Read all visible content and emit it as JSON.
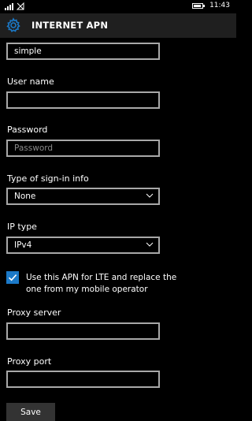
{
  "status_bar": {
    "time": "11:43",
    "icons": [
      "signal-icon",
      "no-signal-icon",
      "battery-icon"
    ]
  },
  "header": {
    "title": "INTERNET APN",
    "icon": "gear-icon"
  },
  "form": {
    "apn_value": "simple",
    "user_name": {
      "label": "User name",
      "value": ""
    },
    "password": {
      "label": "Password",
      "placeholder": "Password"
    },
    "sign_in": {
      "label": "Type of sign-in info",
      "selected": "None"
    },
    "ip_type": {
      "label": "IP type",
      "selected": "IPv4"
    },
    "lte_checkbox": {
      "label": "Use this APN for LTE and replace the one from my mobile operator",
      "checked": true
    },
    "proxy_server": {
      "label": "Proxy server",
      "value": ""
    },
    "proxy_port": {
      "label": "Proxy port",
      "value": ""
    },
    "save_label": "Save"
  },
  "colors": {
    "accent": "#1b79c8",
    "header_bg": "#1f1f1f",
    "border": "#a8a8a8",
    "button_bg": "#333333"
  }
}
